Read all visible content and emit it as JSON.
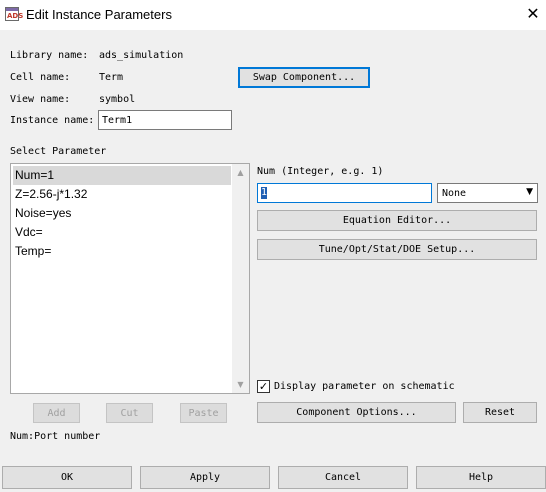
{
  "window": {
    "title": "Edit Instance Parameters",
    "icon_glyph": "ADS"
  },
  "info": {
    "library_label": "Library name:",
    "library_value": "ads_simulation",
    "cell_label": "Cell name:",
    "cell_value": "Term",
    "view_label": "View name:",
    "view_value": "symbol",
    "instance_label": "Instance name:",
    "instance_value": "Term1"
  },
  "buttons": {
    "swap": "Swap Component...",
    "equation": "Equation Editor...",
    "tune": "Tune/Opt/Stat/DOE Setup...",
    "add": "Add",
    "cut": "Cut",
    "paste": "Paste",
    "component_options": "Component Options...",
    "reset": "Reset",
    "ok": "OK",
    "apply": "Apply",
    "cancel": "Cancel",
    "help": "Help"
  },
  "select_parameter": {
    "label": "Select Parameter",
    "items": [
      "Num=1",
      "Z=2.56-j*1.32",
      "Noise=yes",
      "Vdc=",
      "Temp="
    ],
    "selected_index": 0
  },
  "parameter": {
    "label": "Num (Integer, e.g. 1)",
    "value": "1",
    "unit": "None",
    "display_on_schematic": "Display parameter on schematic",
    "display_checked": true
  },
  "status": "Num:Port number",
  "icons": {
    "close": "✕",
    "check": "✓",
    "dropdown": "▼",
    "scroll_up": "▲",
    "scroll_down": "▼"
  }
}
